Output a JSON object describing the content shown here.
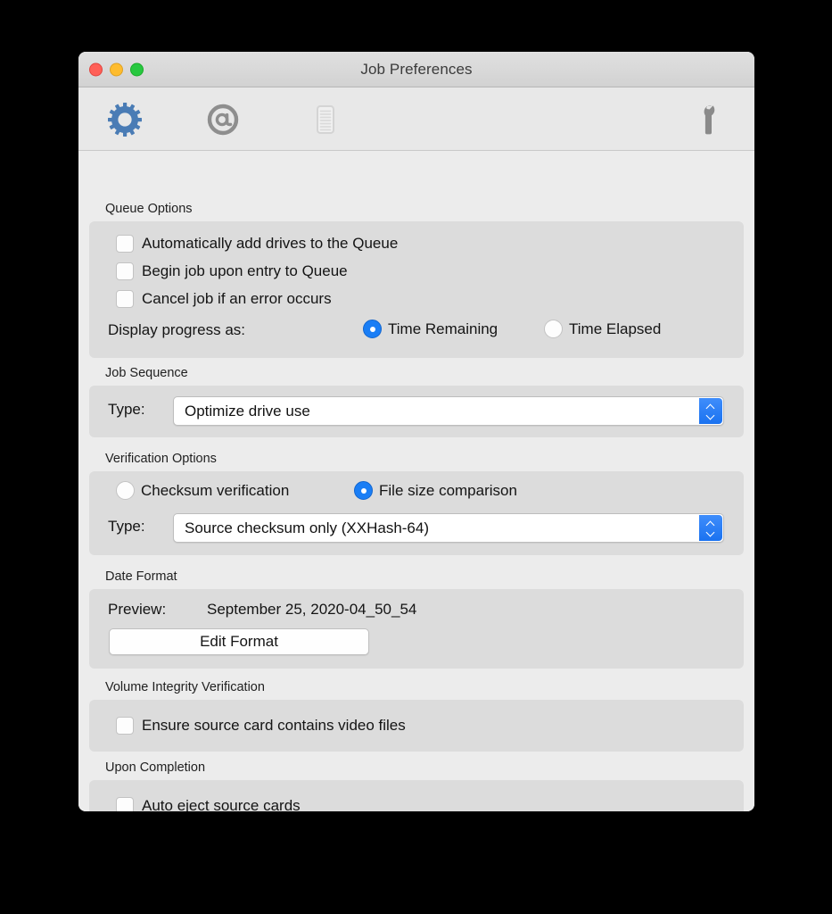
{
  "window": {
    "title": "Job Preferences",
    "traffic_lights": [
      "close-button",
      "minimize-button",
      "zoom-button"
    ]
  },
  "toolbar": {
    "items": [
      {
        "name": "gear-icon",
        "label": "General",
        "selected": true,
        "color": "#4a7cb5"
      },
      {
        "name": "at-icon",
        "label": "Email",
        "selected": false,
        "color": "#8e8e8e"
      },
      {
        "name": "document-icon",
        "label": "Reports",
        "selected": false,
        "color": "#d2d2d2"
      },
      {
        "name": "wrench-icon",
        "label": "Advanced",
        "selected": false,
        "color": "#8a8a8a"
      }
    ]
  },
  "sections": {
    "queue_options": {
      "label": "Queue Options",
      "checkboxes": [
        {
          "label": "Automatically add drives to the Queue",
          "checked": false
        },
        {
          "label": "Begin job upon entry to Queue",
          "checked": false
        },
        {
          "label": "Cancel job if an error occurs",
          "checked": false
        }
      ],
      "progress_label": "Display progress as:",
      "progress_options": [
        {
          "label": "Time Remaining",
          "selected": true
        },
        {
          "label": "Time Elapsed",
          "selected": false
        }
      ]
    },
    "job_sequence": {
      "label": "Job Sequence",
      "type_label": "Type:",
      "type_value": "Optimize drive use"
    },
    "verification_options": {
      "label": "Verification Options",
      "radios": [
        {
          "label": "Checksum verification",
          "selected": false
        },
        {
          "label": "File size comparison",
          "selected": true
        }
      ],
      "type_label": "Type:",
      "type_value": "Source checksum only (XXHash-64)"
    },
    "date_format": {
      "label": "Date Format",
      "preview_label": "Preview:",
      "preview_value": "September 25, 2020-04_50_54",
      "edit_button": "Edit Format"
    },
    "volume_integrity": {
      "label": "Volume Integrity Verification",
      "checkboxes": [
        {
          "label": "Ensure source card contains video files",
          "checked": false
        }
      ]
    },
    "upon_completion": {
      "label": "Upon Completion",
      "checkboxes": [
        {
          "label": "Auto eject source cards",
          "checked": false
        }
      ]
    }
  },
  "colors": {
    "accent_blue": "#1a7ef5",
    "window_bg": "#ececec",
    "group_bg": "#dcdcdc",
    "titlebar_bg": "#d6d6d6"
  }
}
